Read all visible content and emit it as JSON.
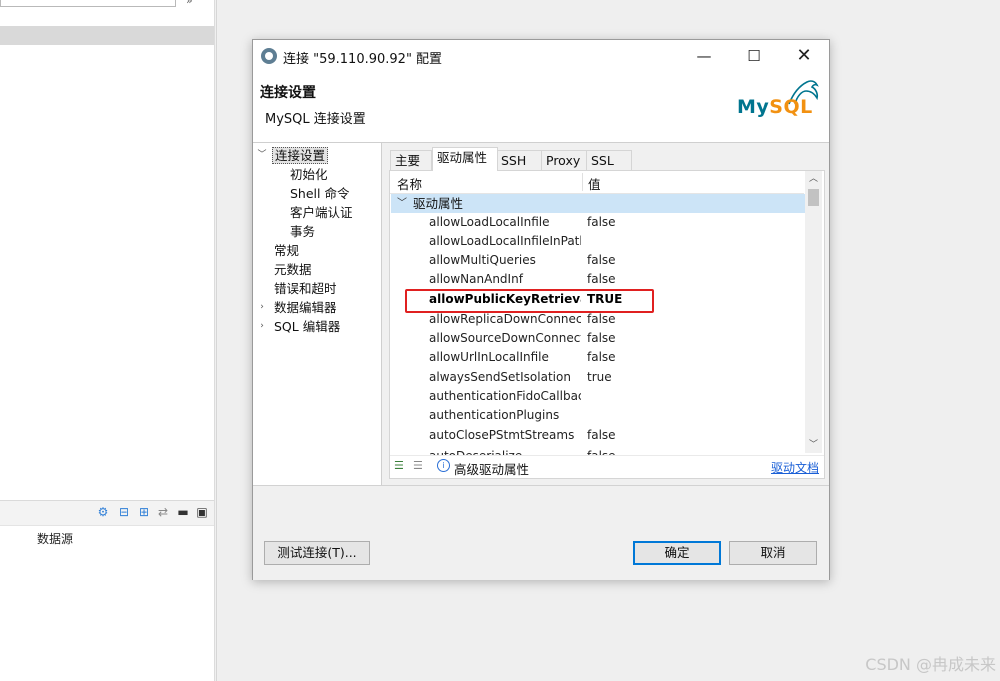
{
  "window": {
    "title": "连接 \"59.110.90.92\" 配置",
    "min_glyph": "—",
    "max_glyph": "☐",
    "close_glyph": "✕"
  },
  "header": {
    "title": "连接设置",
    "subtitle": "MySQL 连接设置",
    "logo": {
      "my": "My",
      "sql": "SQL"
    }
  },
  "tree": [
    {
      "label": "连接设置",
      "expanded": true,
      "selected": true
    },
    {
      "label": "初始化"
    },
    {
      "label": "Shell 命令"
    },
    {
      "label": "客户端认证"
    },
    {
      "label": "事务"
    },
    {
      "label": "常规"
    },
    {
      "label": "元数据"
    },
    {
      "label": "错误和超时"
    },
    {
      "label": "数据编辑器",
      "expandable": true
    },
    {
      "label": "SQL 编辑器",
      "expandable": true
    }
  ],
  "tabs": [
    {
      "label": "主要"
    },
    {
      "label": "驱动属性",
      "active": true
    },
    {
      "label": "SSH"
    },
    {
      "label": "Proxy"
    },
    {
      "label": "SSL"
    }
  ],
  "grid": {
    "columns": [
      "名称",
      "值"
    ],
    "group_label": "驱动属性",
    "rows": [
      {
        "name": "allowLoadLocalInfile",
        "value": "false"
      },
      {
        "name": "allowLoadLocalInfileInPath",
        "value": ""
      },
      {
        "name": "allowMultiQueries",
        "value": "false"
      },
      {
        "name": "allowNanAndInf",
        "value": "false"
      },
      {
        "name": "allowPublicKeyRetrieval",
        "value": "TRUE",
        "highlighted": true
      },
      {
        "name": "allowReplicaDownConnections",
        "value": "false"
      },
      {
        "name": "allowSourceDownConnections",
        "value": "false"
      },
      {
        "name": "allowUrlInLocalInfile",
        "value": "false"
      },
      {
        "name": "alwaysSendSetIsolation",
        "value": "true"
      },
      {
        "name": "authenticationFidoCallback",
        "value": ""
      },
      {
        "name": "authenticationPlugins",
        "value": ""
      },
      {
        "name": "autoClosePStmtStreams",
        "value": "false"
      },
      {
        "name": "autoDeserialize",
        "value": "false"
      }
    ]
  },
  "panel_footer": {
    "advanced_label": "高级驱动属性",
    "docs_link": "驱动文档",
    "info_glyph": "i"
  },
  "buttons": {
    "test": "测试连接(T)...",
    "ok": "确定",
    "cancel": "取消"
  },
  "background": {
    "datasource_label": "数据源",
    "watermark": "CSDN @冉成未来"
  }
}
